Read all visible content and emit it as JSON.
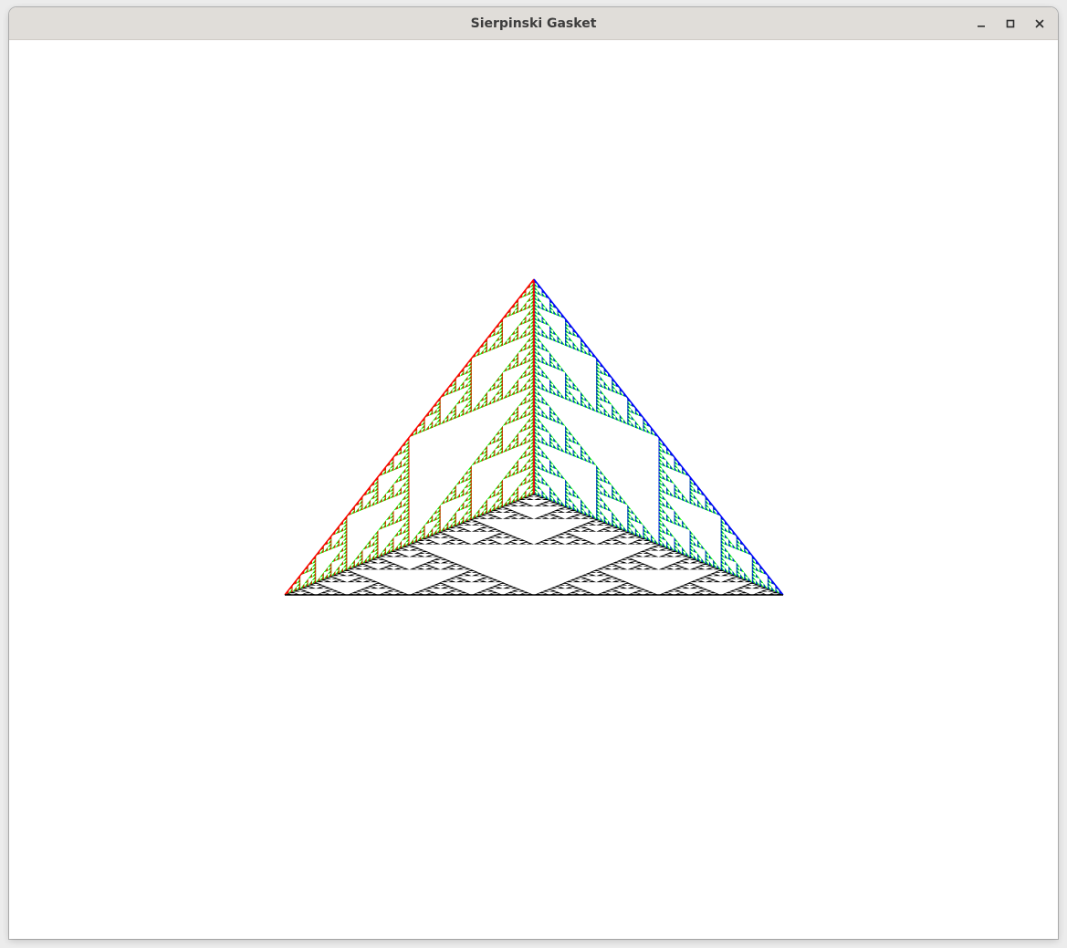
{
  "window": {
    "title": "Sierpinski Gasket",
    "controls": {
      "minimize_icon": "minimize-icon",
      "maximize_icon": "maximize-icon",
      "close_icon": "close-icon"
    }
  },
  "canvas": {
    "background": "#ffffff",
    "figure": "sierpinski-gasket-3d-projection",
    "face_colors": {
      "left": "#ff0000",
      "right": "#0000ff",
      "front_bottom": "#000000",
      "fill": "#00ff00"
    },
    "recursion_depth": 6
  }
}
